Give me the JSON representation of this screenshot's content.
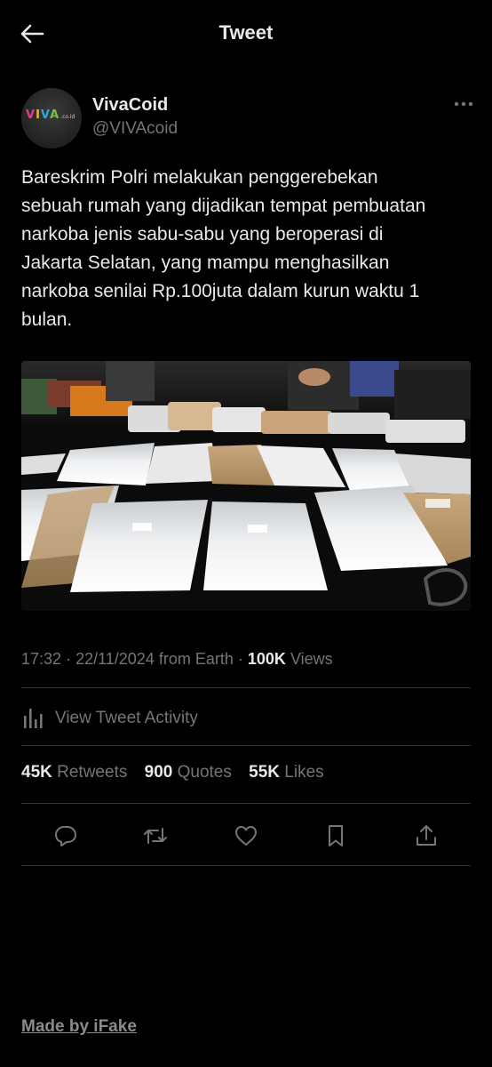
{
  "header": {
    "title": "Tweet",
    "back_icon": "arrow-left-icon"
  },
  "author": {
    "display_name": "VivaCoid",
    "handle": "@VIVAcoid",
    "avatar_logo": {
      "letters": [
        "V",
        "I",
        "V",
        "A"
      ],
      "suffix": ".co.id"
    },
    "more_icon": "more-horizontal-icon"
  },
  "tweet": {
    "text": "Bareskrim Polri melakukan penggerebekan\nsebuah rumah yang dijadikan tempat pembuatan\nnarkoba jenis sabu-sabu yang beroperasi di\nJakarta Selatan, yang mampu menghasilkan\nnarkoba senilai Rp.100juta dalam kurun waktu 1\nbulan.",
    "media": {
      "type": "photo",
      "subject": "seized packets of crystal methamphetamine on a table"
    }
  },
  "meta": {
    "time": "17:32",
    "date": "22/11/2024",
    "source": "from Earth",
    "views_count": "100K",
    "views_label": "Views"
  },
  "activity": {
    "label": "View Tweet Activity",
    "icon": "bar-chart-icon"
  },
  "stats": {
    "retweets_count": "45K",
    "retweets_label": "Retweets",
    "quotes_count": "900",
    "quotes_label": "Quotes",
    "likes_count": "55K",
    "likes_label": "Likes"
  },
  "actions": [
    {
      "name": "reply",
      "icon": "reply-icon"
    },
    {
      "name": "retweet",
      "icon": "retweet-icon"
    },
    {
      "name": "like",
      "icon": "heart-icon"
    },
    {
      "name": "bookmark",
      "icon": "bookmark-icon"
    },
    {
      "name": "share",
      "icon": "share-icon"
    }
  ],
  "footer": {
    "credit": "Made by iFake"
  },
  "colors": {
    "background": "#000000",
    "text_primary": "#e7e9ea",
    "text_secondary": "#71767b",
    "divider": "#2f3336"
  }
}
